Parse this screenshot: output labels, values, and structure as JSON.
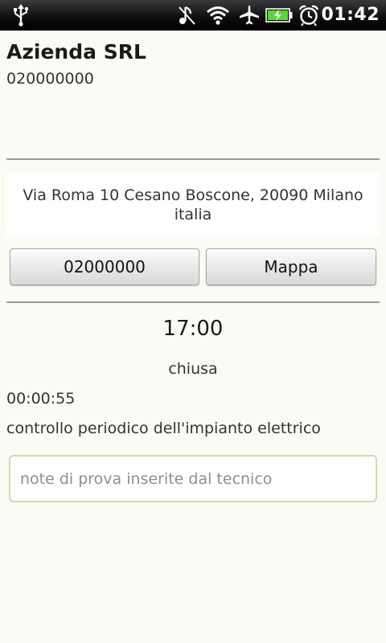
{
  "status_bar": {
    "icons": [
      "usb-icon",
      "music-muted-icon",
      "wifi-icon",
      "airplane-icon",
      "battery-charging-icon",
      "alarm-clock-icon"
    ],
    "clock": "01:42"
  },
  "customer": {
    "name": "Azienda SRL",
    "code": "020000000"
  },
  "address": "Via Roma 10 Cesano Boscone, 20090 Milano italia",
  "actions": {
    "phone_label": "02000000",
    "map_label": "Mappa"
  },
  "intervention": {
    "time": "17:00",
    "state": "chiusa",
    "duration": "00:00:55",
    "description": "controllo periodico dell'impianto elettrico"
  },
  "notes": {
    "placeholder": "note di prova inserite dal tecnico",
    "value": ""
  },
  "colors": {
    "background": "#fbfbf5",
    "status_bar": "#000000",
    "battery_fill": "#5fd33a",
    "notes_border": "#c8dfa9",
    "divider": "#9a9a96"
  }
}
